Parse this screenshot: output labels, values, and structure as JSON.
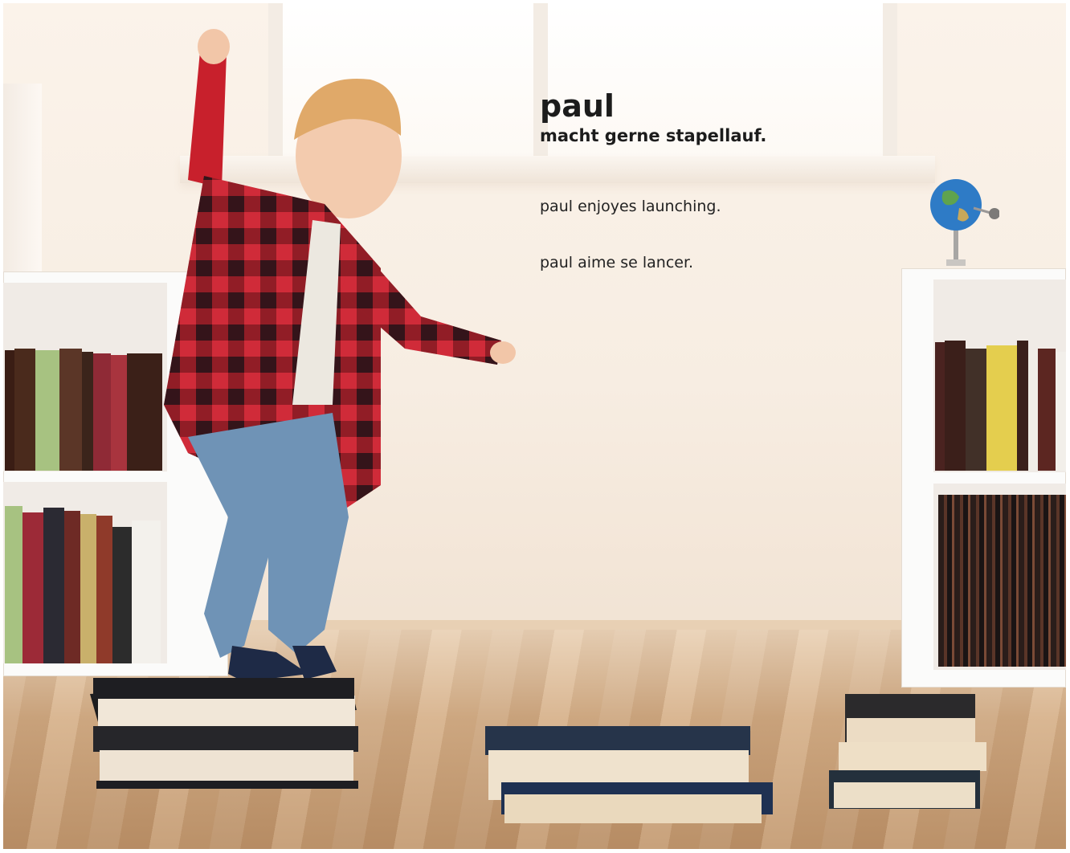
{
  "caption": {
    "title": "paul",
    "subtitle": "macht gerne stapellauf.",
    "english": "paul enjoyes launching.",
    "french": "paul aime se lancer."
  }
}
